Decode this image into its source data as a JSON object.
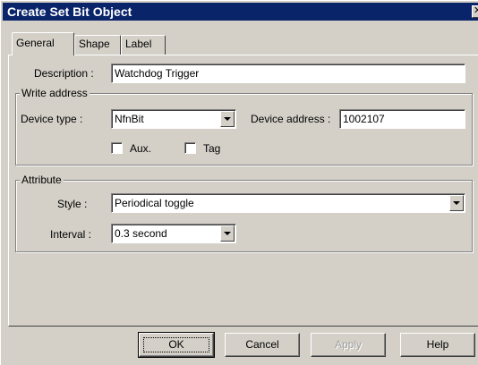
{
  "window": {
    "title": "Create Set Bit Object"
  },
  "tabs": [
    {
      "label": "General"
    },
    {
      "label": "Shape"
    },
    {
      "label": "Label"
    }
  ],
  "general": {
    "description_label": "Description :",
    "description_value": "Watchdog Trigger",
    "write_address_group": "Write address",
    "device_type_label": "Device type :",
    "device_type_value": "NfnBit",
    "device_address_label": "Device address :",
    "device_address_value": "1002107",
    "aux_label": "Aux.",
    "aux_checked": false,
    "tag_label": "Tag",
    "tag_checked": false,
    "attribute_group": "Attribute",
    "style_label": "Style :",
    "style_value": "Periodical toggle",
    "interval_label": "Interval :",
    "interval_value": "0.3 second"
  },
  "buttons": {
    "ok": "OK",
    "cancel": "Cancel",
    "apply": "Apply",
    "help": "Help"
  },
  "icons": {
    "close": "close-icon",
    "dropdown": "chevron-down-icon"
  }
}
